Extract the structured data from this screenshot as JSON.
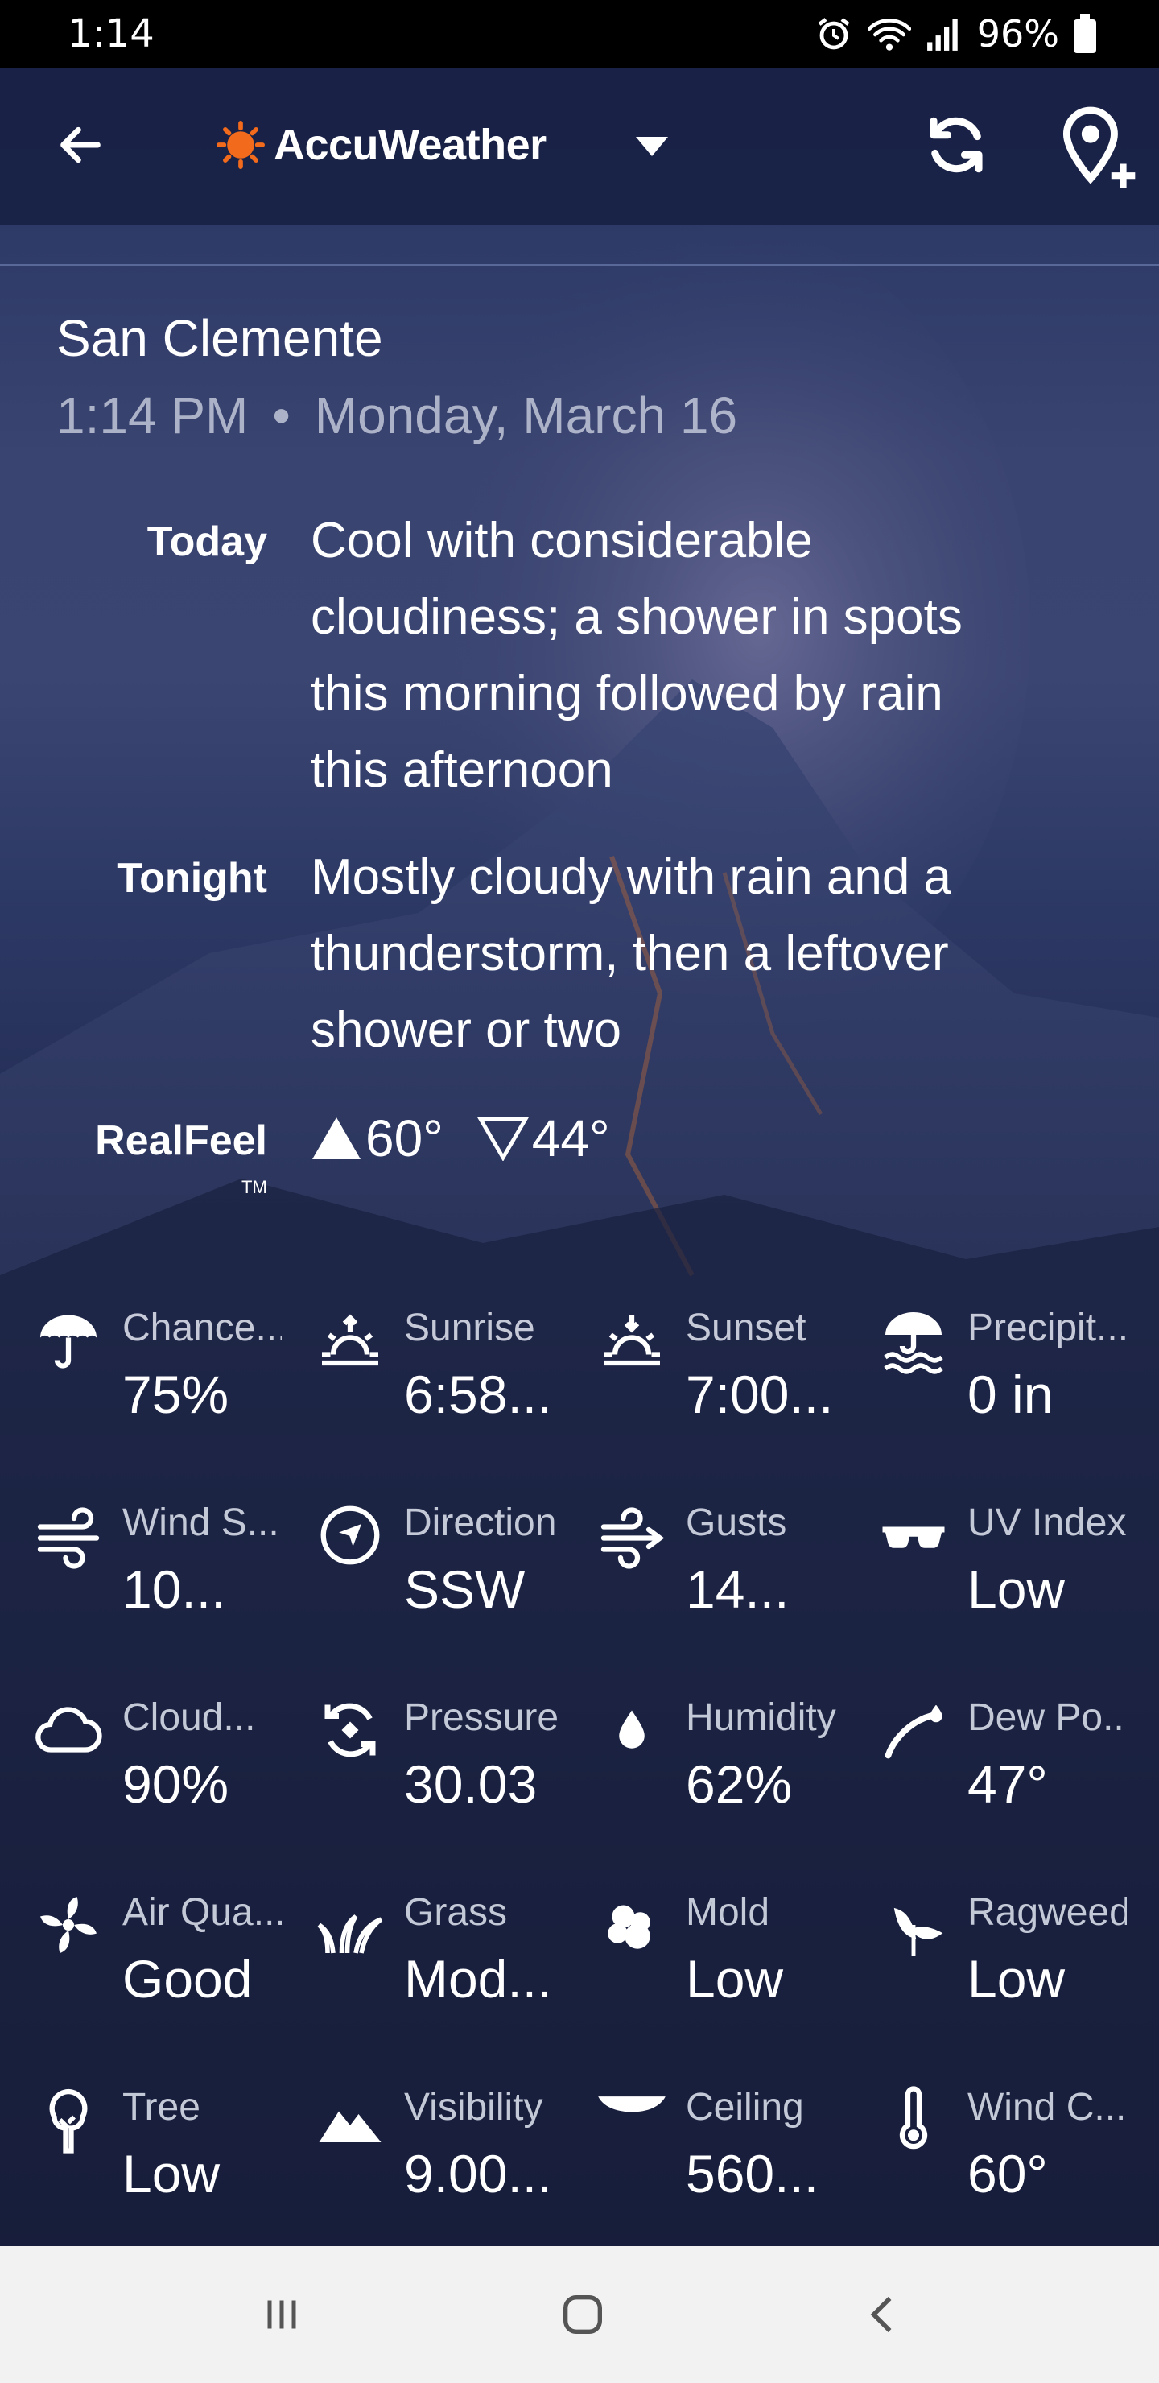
{
  "status_bar": {
    "time": "1:14",
    "battery": "96%",
    "icons": [
      "alarm-icon",
      "wifi-icon",
      "signal-icon",
      "battery-icon"
    ]
  },
  "toolbar": {
    "brand": "AccuWeather",
    "icons": [
      "back-arrow-icon",
      "sun-logo-icon",
      "dropdown-caret-icon",
      "refresh-icon",
      "add-location-icon"
    ]
  },
  "location": {
    "name": "San Clemente",
    "time": "1:14 PM",
    "separator": "•",
    "date": "Monday, March 16"
  },
  "forecast": {
    "today_label": "Today",
    "today_lines": [
      "Cool with considerable",
      "cloudiness; a shower in spots",
      "this morning followed by rain",
      "this afternoon"
    ],
    "tonight_label": "Tonight",
    "tonight_lines": [
      "Mostly cloudy with rain and a",
      "thunderstorm, then a leftover",
      "shower or two"
    ]
  },
  "realfeel": {
    "label": "RealFeel",
    "tm": "TM",
    "high": "60°",
    "low": "44°"
  },
  "details": [
    {
      "icon": "umbrella-icon",
      "label": "Chance...",
      "value": "75%"
    },
    {
      "icon": "sunrise-icon",
      "label": "Sunrise",
      "value": "6:58..."
    },
    {
      "icon": "sunset-icon",
      "label": "Sunset",
      "value": "7:00..."
    },
    {
      "icon": "precipitation-icon",
      "label": "Precipit...",
      "value": "0 in"
    },
    {
      "icon": "wind-icon",
      "label": "Wind S...",
      "value": "10..."
    },
    {
      "icon": "compass-icon",
      "label": "Direction",
      "value": "SSW"
    },
    {
      "icon": "gusts-icon",
      "label": "Gusts",
      "value": "14..."
    },
    {
      "icon": "sunglasses-icon",
      "label": "UV Index",
      "value": "Low"
    },
    {
      "icon": "cloud-icon",
      "label": "Cloud...",
      "value": "90%"
    },
    {
      "icon": "pressure-icon",
      "label": "Pressure",
      "value": "30.03"
    },
    {
      "icon": "droplet-icon",
      "label": "Humidity",
      "value": "62%"
    },
    {
      "icon": "dew-point-icon",
      "label": "Dew Po...",
      "value": "47°"
    },
    {
      "icon": "fan-icon",
      "label": "Air Qua...",
      "value": "Good"
    },
    {
      "icon": "grass-icon",
      "label": "Grass",
      "value": "Mod..."
    },
    {
      "icon": "mold-icon",
      "label": "Mold",
      "value": "Low"
    },
    {
      "icon": "ragweed-icon",
      "label": "Ragweed",
      "value": "Low"
    },
    {
      "icon": "tree-icon",
      "label": "Tree",
      "value": "Low"
    },
    {
      "icon": "mountains-icon",
      "label": "Visibility",
      "value": "9.00..."
    },
    {
      "icon": "ceiling-icon",
      "label": "Ceiling",
      "value": "560..."
    },
    {
      "icon": "thermometer-icon",
      "label": "Wind C...",
      "value": "60°"
    }
  ],
  "navbar": {
    "icons": [
      "recent-apps-icon",
      "home-icon",
      "back-icon"
    ]
  },
  "colors": {
    "accent_orange": "#f26a1b",
    "toolbar_bg": "#1b2446",
    "navbar_bg": "#f2f2f2"
  }
}
